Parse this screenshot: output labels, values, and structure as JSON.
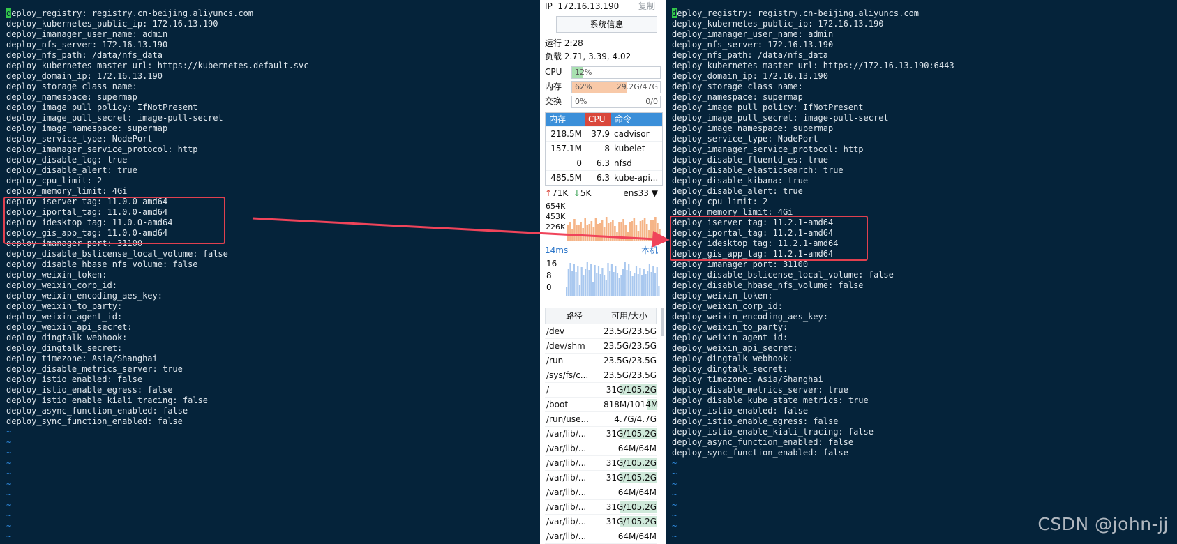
{
  "left_terminal": {
    "lines": [
      "deploy_registry: registry.cn-beijing.aliyuncs.com",
      "deploy_kubernetes_public_ip: 172.16.13.190",
      "deploy_imanager_user_name: admin",
      "deploy_nfs_server: 172.16.13.190",
      "deploy_nfs_path: /data/nfs_data",
      "deploy_kubernetes_master_url: https://kubernetes.default.svc",
      "deploy_domain_ip: 172.16.13.190",
      "deploy_storage_class_name:",
      "deploy_namespace: supermap",
      "deploy_image_pull_policy: IfNotPresent",
      "deploy_image_pull_secret: image-pull-secret",
      "deploy_image_namespace: supermap",
      "deploy_service_type: NodePort",
      "deploy_imanager_service_protocol: http",
      "deploy_disable_log: true",
      "deploy_disable_alert: true",
      "deploy_cpu_limit: 2",
      "deploy_memory_limit: 4Gi",
      "deploy_iserver_tag: 11.0.0-amd64",
      "deploy_iportal_tag: 11.0.0-amd64",
      "deploy_idesktop_tag: 11.0.0-amd64",
      "deploy_gis_app_tag: 11.0.0-amd64",
      "deploy_imanager_port: 31100",
      "deploy_disable_bslicense_local_volume: false",
      "deploy_disable_hbase_nfs_volume: false",
      "deploy_weixin_token:",
      "deploy_weixin_corp_id:",
      "deploy_weixin_encoding_aes_key:",
      "deploy_weixin_to_party:",
      "deploy_weixin_agent_id:",
      "deploy_weixin_api_secret:",
      "deploy_dingtalk_webhook:",
      "deploy_dingtalk_secret:",
      "deploy_timezone: Asia/Shanghai",
      "deploy_disable_metrics_server: true",
      "deploy_istio_enabled: false",
      "deploy_istio_enable_egress: false",
      "deploy_istio_enable_kiali_tracing: false",
      "deploy_async_function_enabled: false",
      "deploy_sync_function_enabled: false"
    ],
    "tilde": "~",
    "tilde_count": 11
  },
  "right_terminal": {
    "lines": [
      "deploy_registry: registry.cn-beijing.aliyuncs.com",
      "deploy_kubernetes_public_ip: 172.16.13.190",
      "deploy_imanager_user_name: admin",
      "deploy_nfs_server: 172.16.13.190",
      "deploy_nfs_path: /data/nfs_data",
      "deploy_kubernetes_master_url: https://172.16.13.190:6443",
      "deploy_domain_ip: 172.16.13.190",
      "deploy_storage_class_name:",
      "deploy_namespace: supermap",
      "deploy_image_pull_policy: IfNotPresent",
      "deploy_image_pull_secret: image-pull-secret",
      "deploy_image_namespace: supermap",
      "deploy_service_type: NodePort",
      "deploy_imanager_service_protocol: http",
      "deploy_disable_fluentd_es: true",
      "deploy_disable_elasticsearch: true",
      "deploy_disable_kibana: true",
      "deploy_disable_alert: true",
      "deploy_cpu_limit: 2",
      "deploy_memory_limit: 4Gi",
      "deploy_iserver_tag: 11.2.1-amd64",
      "deploy_iportal_tag: 11.2.1-amd64",
      "deploy_idesktop_tag: 11.2.1-amd64",
      "deploy_gis_app_tag: 11.2.1-amd64",
      "deploy_imanager_port: 31100",
      "deploy_disable_bslicense_local_volume: false",
      "deploy_disable_hbase_nfs_volume: false",
      "deploy_weixin_token:",
      "deploy_weixin_corp_id:",
      "deploy_weixin_encoding_aes_key:",
      "deploy_weixin_to_party:",
      "deploy_weixin_agent_id:",
      "deploy_weixin_api_secret:",
      "deploy_dingtalk_webhook:",
      "deploy_dingtalk_secret:",
      "deploy_timezone: Asia/Shanghai",
      "deploy_disable_metrics_server: true",
      "deploy_disable_kube_state_metrics: true",
      "deploy_istio_enabled: false",
      "deploy_istio_enable_egress: false",
      "deploy_istio_enable_kiali_tracing: false",
      "deploy_async_function_enabled: false",
      "deploy_sync_function_enabled: false"
    ],
    "tilde": "~",
    "tilde_count": 8
  },
  "monitor": {
    "ip_label": "IP",
    "ip": "172.16.13.190",
    "copy": "复制",
    "sysinfo_button": "系统信息",
    "uptime": "运行 2:28",
    "load": "负载 2.71, 3.39, 4.02",
    "cpu": {
      "label": "CPU",
      "text": "12%",
      "fraction": 0.12,
      "color": "#a8e0b0"
    },
    "mem": {
      "label": "内存",
      "text": "62%",
      "size": "29.2G/47G",
      "fraction": 0.62,
      "color": "#f8c9a8"
    },
    "swap": {
      "label": "交换",
      "text": "0%",
      "size": "0/0",
      "fraction": 0.0,
      "color": "#cfe4f8"
    },
    "proc_headers": {
      "mem": "内存",
      "cpu": "CPU",
      "cmd": "命令"
    },
    "proc_header_colors": {
      "mem": "#3b8fd9",
      "cpu": "#d9473b",
      "cmd": "#3b8fd9"
    },
    "processes": [
      {
        "mem": "218.5M",
        "cpu": "37.9",
        "cmd": "cadvisor"
      },
      {
        "mem": "157.1M",
        "cpu": "8",
        "cmd": "kubelet"
      },
      {
        "mem": "0",
        "cpu": "6.3",
        "cmd": "nfsd"
      },
      {
        "mem": "485.5M",
        "cpu": "6.3",
        "cmd": "kube-api..."
      }
    ],
    "net": {
      "up": "71K",
      "down": "5K",
      "iface": "ens33",
      "ticks": [
        "654K",
        "453K",
        "226K"
      ]
    },
    "ping": {
      "latency": "14ms",
      "target": "本机",
      "ticks": [
        "16",
        "8",
        "0"
      ]
    },
    "disk_headers": {
      "path": "路径",
      "size": "可用/大小"
    },
    "disks": [
      {
        "path": "/dev",
        "size": "23.5G/23.5G",
        "used": 0.0
      },
      {
        "path": "/dev/shm",
        "size": "23.5G/23.5G",
        "used": 0.0
      },
      {
        "path": "/run",
        "size": "23.5G/23.5G",
        "used": 0.0
      },
      {
        "path": "/sys/fs/c...",
        "size": "23.5G/23.5G",
        "used": 0.0
      },
      {
        "path": "/",
        "size": "31G/105.2G",
        "used": 0.7
      },
      {
        "path": "/boot",
        "size": "818M/1014M",
        "used": 0.19
      },
      {
        "path": "/run/use...",
        "size": "4.7G/4.7G",
        "used": 0.0
      },
      {
        "path": "/var/lib/...",
        "size": "31G/105.2G",
        "used": 0.7
      },
      {
        "path": "/var/lib/...",
        "size": "64M/64M",
        "used": 0.0
      },
      {
        "path": "/var/lib/...",
        "size": "31G/105.2G",
        "used": 0.7
      },
      {
        "path": "/var/lib/...",
        "size": "31G/105.2G",
        "used": 0.7
      },
      {
        "path": "/var/lib/...",
        "size": "64M/64M",
        "used": 0.0
      },
      {
        "path": "/var/lib/...",
        "size": "31G/105.2G",
        "used": 0.7
      },
      {
        "path": "/var/lib/...",
        "size": "31G/105.2G",
        "used": 0.7
      },
      {
        "path": "/var/lib/...",
        "size": "64M/64M",
        "used": 0.0
      },
      {
        "path": "/var/lib/...",
        "size": "31G/105.2G",
        "used": 0.7
      }
    ]
  },
  "watermark": "CSDN @john-jj",
  "colors": {
    "terminal_bg": "#05233a",
    "highlight": "#e0404f",
    "cursor": "#34c94b"
  }
}
